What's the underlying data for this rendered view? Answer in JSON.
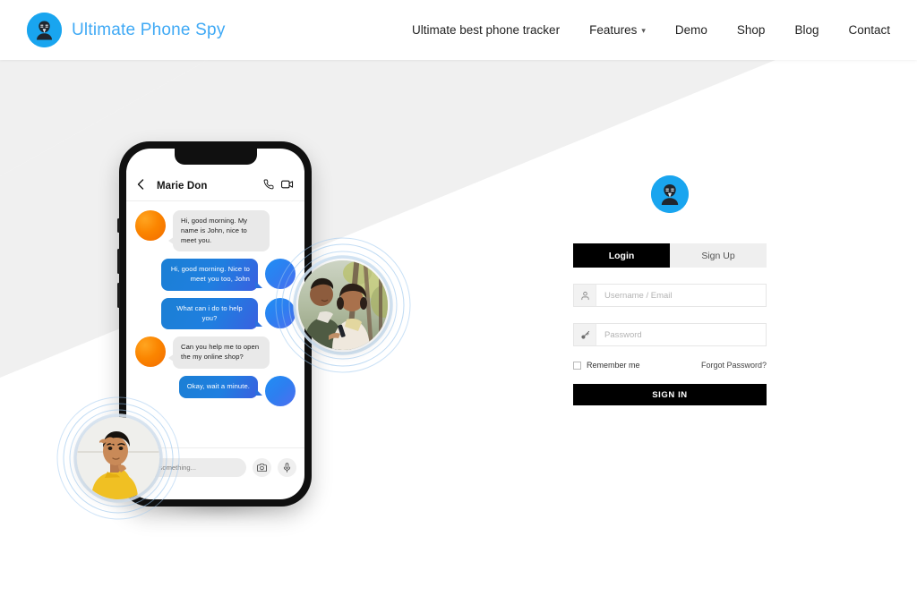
{
  "header": {
    "brand_name": "Ultimate Phone Spy",
    "logo_icon": "spy-mask-avatar-icon",
    "nav": [
      {
        "label": "Ultimate best phone tracker",
        "has_caret": false
      },
      {
        "label": "Features",
        "has_caret": true,
        "caret_icon": "chevron-down-icon"
      },
      {
        "label": "Demo",
        "has_caret": false
      },
      {
        "label": "Shop",
        "has_caret": false
      },
      {
        "label": "Blog",
        "has_caret": false
      },
      {
        "label": "Contact",
        "has_caret": false
      }
    ]
  },
  "phone": {
    "chat": {
      "back_icon": "chevron-left-icon",
      "contact_name": "Marie Don",
      "call_icon": "phone-call-icon",
      "video_icon": "video-camera-icon",
      "messages": [
        {
          "dir": "in",
          "text": "Hi, good morning. My name is John, nice to meet you.",
          "avatar": "orange-avatar"
        },
        {
          "dir": "out",
          "text": "Hi, good morning. Nice to meet you too, John",
          "avatar": "blue-avatar"
        },
        {
          "dir": "out",
          "text": "What can i do to help you?",
          "avatar": "blue-avatar"
        },
        {
          "dir": "in",
          "text": "Can you help me to open the my online shop?",
          "avatar": "orange-avatar"
        },
        {
          "dir": "out",
          "text": "Okay, wait a minute.",
          "avatar": "blue-avatar"
        }
      ],
      "input_placeholder": "Type something...",
      "camera_icon": "camera-icon",
      "mic_icon": "microphone-icon"
    }
  },
  "photos": {
    "couple": "couple-looking-at-phone-photo",
    "man": "man-thinking-yellow-shirt-photo"
  },
  "login": {
    "avatar_icon": "spy-mask-avatar-icon",
    "tabs": [
      {
        "label": "Login",
        "active": true
      },
      {
        "label": "Sign Up",
        "active": false
      }
    ],
    "username": {
      "placeholder": "Username / Email",
      "value": "",
      "icon": "user-icon"
    },
    "password": {
      "placeholder": "Password",
      "value": "",
      "icon": "key-icon"
    },
    "remember_label": "Remember me",
    "remember_checked": false,
    "forgot_label": "Forgot Password?",
    "submit_label": "SIGN IN"
  },
  "colors": {
    "brand_blue": "#3fa9f5",
    "logo_blue": "#19a5ef",
    "bubble_blue": "#1f7fe0",
    "avatar_orange": "#fb8500",
    "band_gray": "#f0f0f0",
    "black": "#000000"
  }
}
